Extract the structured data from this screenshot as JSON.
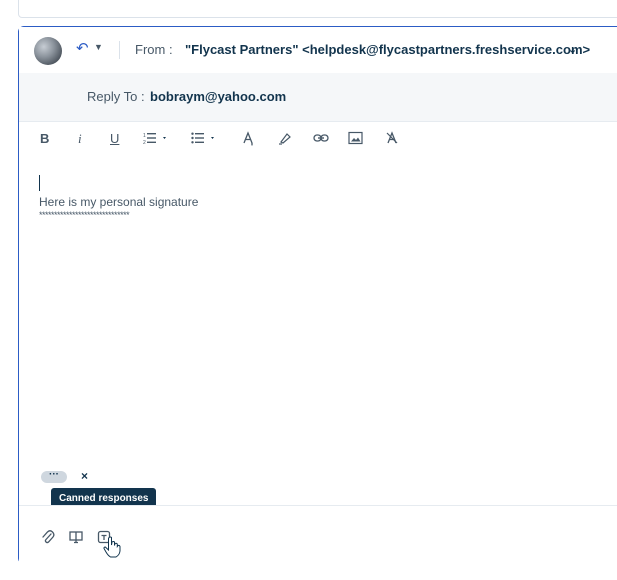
{
  "from": {
    "label": "From :",
    "value": "\"Flycast Partners\" <helpdesk@flycastpartners.freshservice.com>"
  },
  "reply_to": {
    "label": "Reply To :",
    "value": "bobraym@yahoo.com"
  },
  "editor": {
    "signature": "Here is my personal signature",
    "stars": "******************************"
  },
  "toolbar_icons": [
    "bold-icon",
    "italic-icon",
    "underline-icon",
    "ordered-list-icon",
    "bullet-list-icon",
    "text-color-icon",
    "highlight-icon",
    "link-icon",
    "image-icon",
    "clear-format-icon"
  ],
  "toolbar": {
    "bold": "B",
    "italic": "i",
    "underline": "U"
  },
  "footer": {
    "more": "···",
    "close": "×",
    "tooltip": "Canned responses"
  },
  "colors": {
    "accent": "#2c5cc5",
    "text": "#12344d",
    "muted": "#475867",
    "tooltip_bg": "#12344d"
  }
}
